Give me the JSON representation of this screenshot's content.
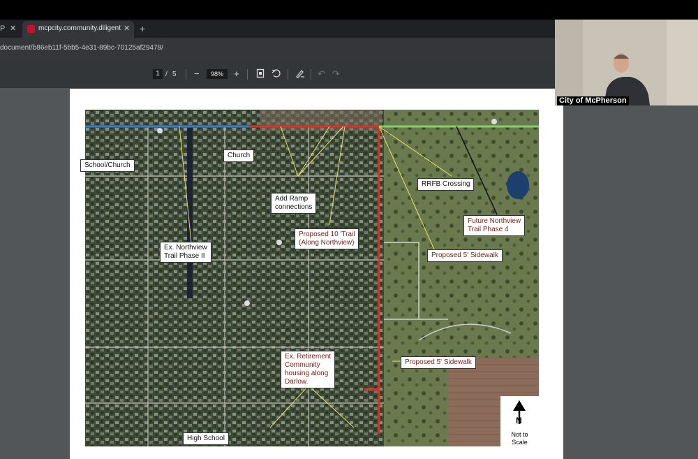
{
  "browser": {
    "prev_tab_label": "P",
    "active_tab_title": "mcpcity.community.diligentone",
    "new_tab_icon": "plus-icon",
    "url": "document/b86eb11f-5bb5-4e31-89bc-70125af29478/"
  },
  "pdf_toolbar": {
    "current_page": "1",
    "page_separator": "/",
    "total_pages": "5",
    "zoom": "98%"
  },
  "map": {
    "labels": {
      "school_church": "School/Church",
      "church": "Church",
      "add_ramp_1": "Add Ramp",
      "add_ramp_2": "connections",
      "rrfb": "RRFB Crossing",
      "future_1": "Future Northview",
      "future_2": "Trail Phase 4",
      "proposed_trail_1": "Proposed 10 'Trail",
      "proposed_trail_2": "(Along Northview)",
      "ex_northview_1": "Ex. Northview",
      "ex_northview_2": "Trail Phase II",
      "sidewalk_1": "Proposed 5' Sidewalk",
      "sidewalk_2": "Proposed 5' Sidewalk",
      "retirement_1": "Ex. Retirement",
      "retirement_2": "Community",
      "retirement_3": "housing along",
      "retirement_4": "Darlow.",
      "high_school": "High School"
    },
    "north_arrow": {
      "letter": "N",
      "note_1": "Not to",
      "note_2": "Scale"
    },
    "colors": {
      "existing_trail": "#3a7bd5",
      "proposed_trail": "#e03020",
      "future_trail": "#7fd36a",
      "leader_lines": "#e8e070"
    }
  },
  "webcam": {
    "caption": "City of McPherson"
  }
}
